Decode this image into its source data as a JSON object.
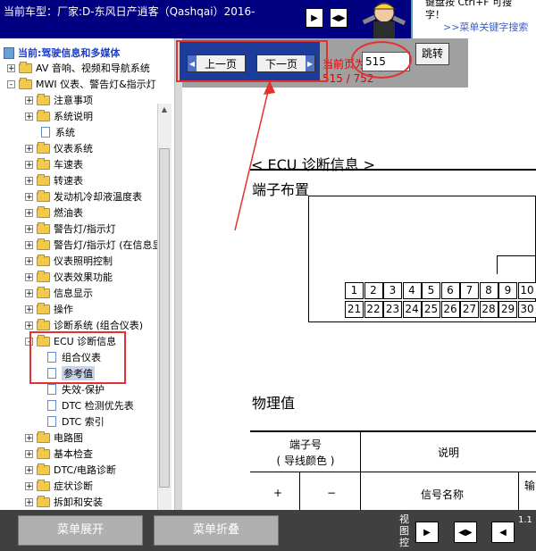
{
  "topbar": {
    "car_title": "当前车型：厂家:D-东风日产逍客（Qashqai）2016-",
    "hint_line1": "键盘按 Ctrl+F 可搜",
    "hint_line2": "字！",
    "hint_link": ">>菜单关键字搜索"
  },
  "sidebar": {
    "current": "当前:驾驶信息和多媒体",
    "items": [
      {
        "label": "AV 音响、视频和导航系统",
        "type": "folder",
        "level": 0,
        "expander": "+"
      },
      {
        "label": "MWI 仪表、警告灯&指示灯",
        "type": "folder",
        "level": 0,
        "expander": "-"
      },
      {
        "label": "注意事项",
        "type": "folder",
        "level": 1,
        "expander": "+"
      },
      {
        "label": "系统说明",
        "type": "folder",
        "level": 1,
        "expander": "+"
      },
      {
        "label": "系统",
        "type": "doc",
        "level": 1,
        "expander": ""
      },
      {
        "label": "仪表系统",
        "type": "folder",
        "level": 1,
        "expander": "+"
      },
      {
        "label": "车速表",
        "type": "folder",
        "level": 1,
        "expander": "+"
      },
      {
        "label": "转速表",
        "type": "folder",
        "level": 1,
        "expander": "+"
      },
      {
        "label": "发动机冷却液温度表",
        "type": "folder",
        "level": 1,
        "expander": "+"
      },
      {
        "label": "燃油表",
        "type": "folder",
        "level": 1,
        "expander": "+"
      },
      {
        "label": "警告灯/指示灯",
        "type": "folder",
        "level": 1,
        "expander": "+"
      },
      {
        "label": "警告灯/指示灯 (在信息显",
        "type": "folder",
        "level": 1,
        "expander": "+"
      },
      {
        "label": "仪表照明控制",
        "type": "folder",
        "level": 1,
        "expander": "+"
      },
      {
        "label": "仪表效果功能",
        "type": "folder",
        "level": 1,
        "expander": "+"
      },
      {
        "label": "信息显示",
        "type": "folder",
        "level": 1,
        "expander": "+"
      },
      {
        "label": "操作",
        "type": "folder",
        "level": 1,
        "expander": "+"
      },
      {
        "label": "诊断系统 (组合仪表)",
        "type": "folder",
        "level": 1,
        "expander": "+"
      },
      {
        "label": "ECU 诊断信息",
        "type": "folder",
        "level": 1,
        "expander": "-"
      },
      {
        "label": "组合仪表",
        "type": "doc",
        "level": 2,
        "expander": ""
      },
      {
        "label": "参考值",
        "type": "doc",
        "level": 2,
        "expander": "",
        "selected": true
      },
      {
        "label": "失效-保护",
        "type": "doc",
        "level": 2,
        "expander": ""
      },
      {
        "label": "DTC 检测优先表",
        "type": "doc",
        "level": 2,
        "expander": ""
      },
      {
        "label": "DTC 索引",
        "type": "doc",
        "level": 2,
        "expander": ""
      },
      {
        "label": "电路图",
        "type": "folder",
        "level": 1,
        "expander": "+"
      },
      {
        "label": "基本检查",
        "type": "folder",
        "level": 1,
        "expander": "+"
      },
      {
        "label": "DTC/电路诊断",
        "type": "folder",
        "level": 1,
        "expander": "+"
      },
      {
        "label": "症状诊断",
        "type": "folder",
        "level": 1,
        "expander": "+"
      },
      {
        "label": "拆卸和安装",
        "type": "folder",
        "level": 1,
        "expander": "+"
      }
    ]
  },
  "toolbar": {
    "prev_label": "上一页",
    "next_label": "下一页",
    "current_page_label": "当前页为",
    "page_input_value": "515",
    "page_count": "515 / 752",
    "go_label": "跳转"
  },
  "document": {
    "section_title": "< ECU 诊断信息 >",
    "terminal_layout_heading": "端子布置",
    "pins_row1": [
      "1",
      "2",
      "3",
      "4",
      "5",
      "6",
      "7",
      "8",
      "9",
      "10"
    ],
    "pins_row2": [
      "21",
      "22",
      "23",
      "24",
      "25",
      "26",
      "27",
      "28",
      "29",
      "30"
    ],
    "physical_values_heading": "物理值",
    "table": {
      "terminal_header": "端子号",
      "wire_color_header": "( 导线颜色 )",
      "desc_header": "说明",
      "plus": "+",
      "minus": "−",
      "signal_name": "信号名称",
      "partial_col": "输"
    }
  },
  "bottombar": {
    "expand_label": "菜单展开",
    "collapse_label": "菜单折叠",
    "view_label": "视图控",
    "version": "1.1"
  },
  "colors": {
    "topbar_bg": "#000080",
    "navbox_bg": "#1c3c9c",
    "annotation_red": "#e53030",
    "bottombar_bg": "#404040"
  }
}
